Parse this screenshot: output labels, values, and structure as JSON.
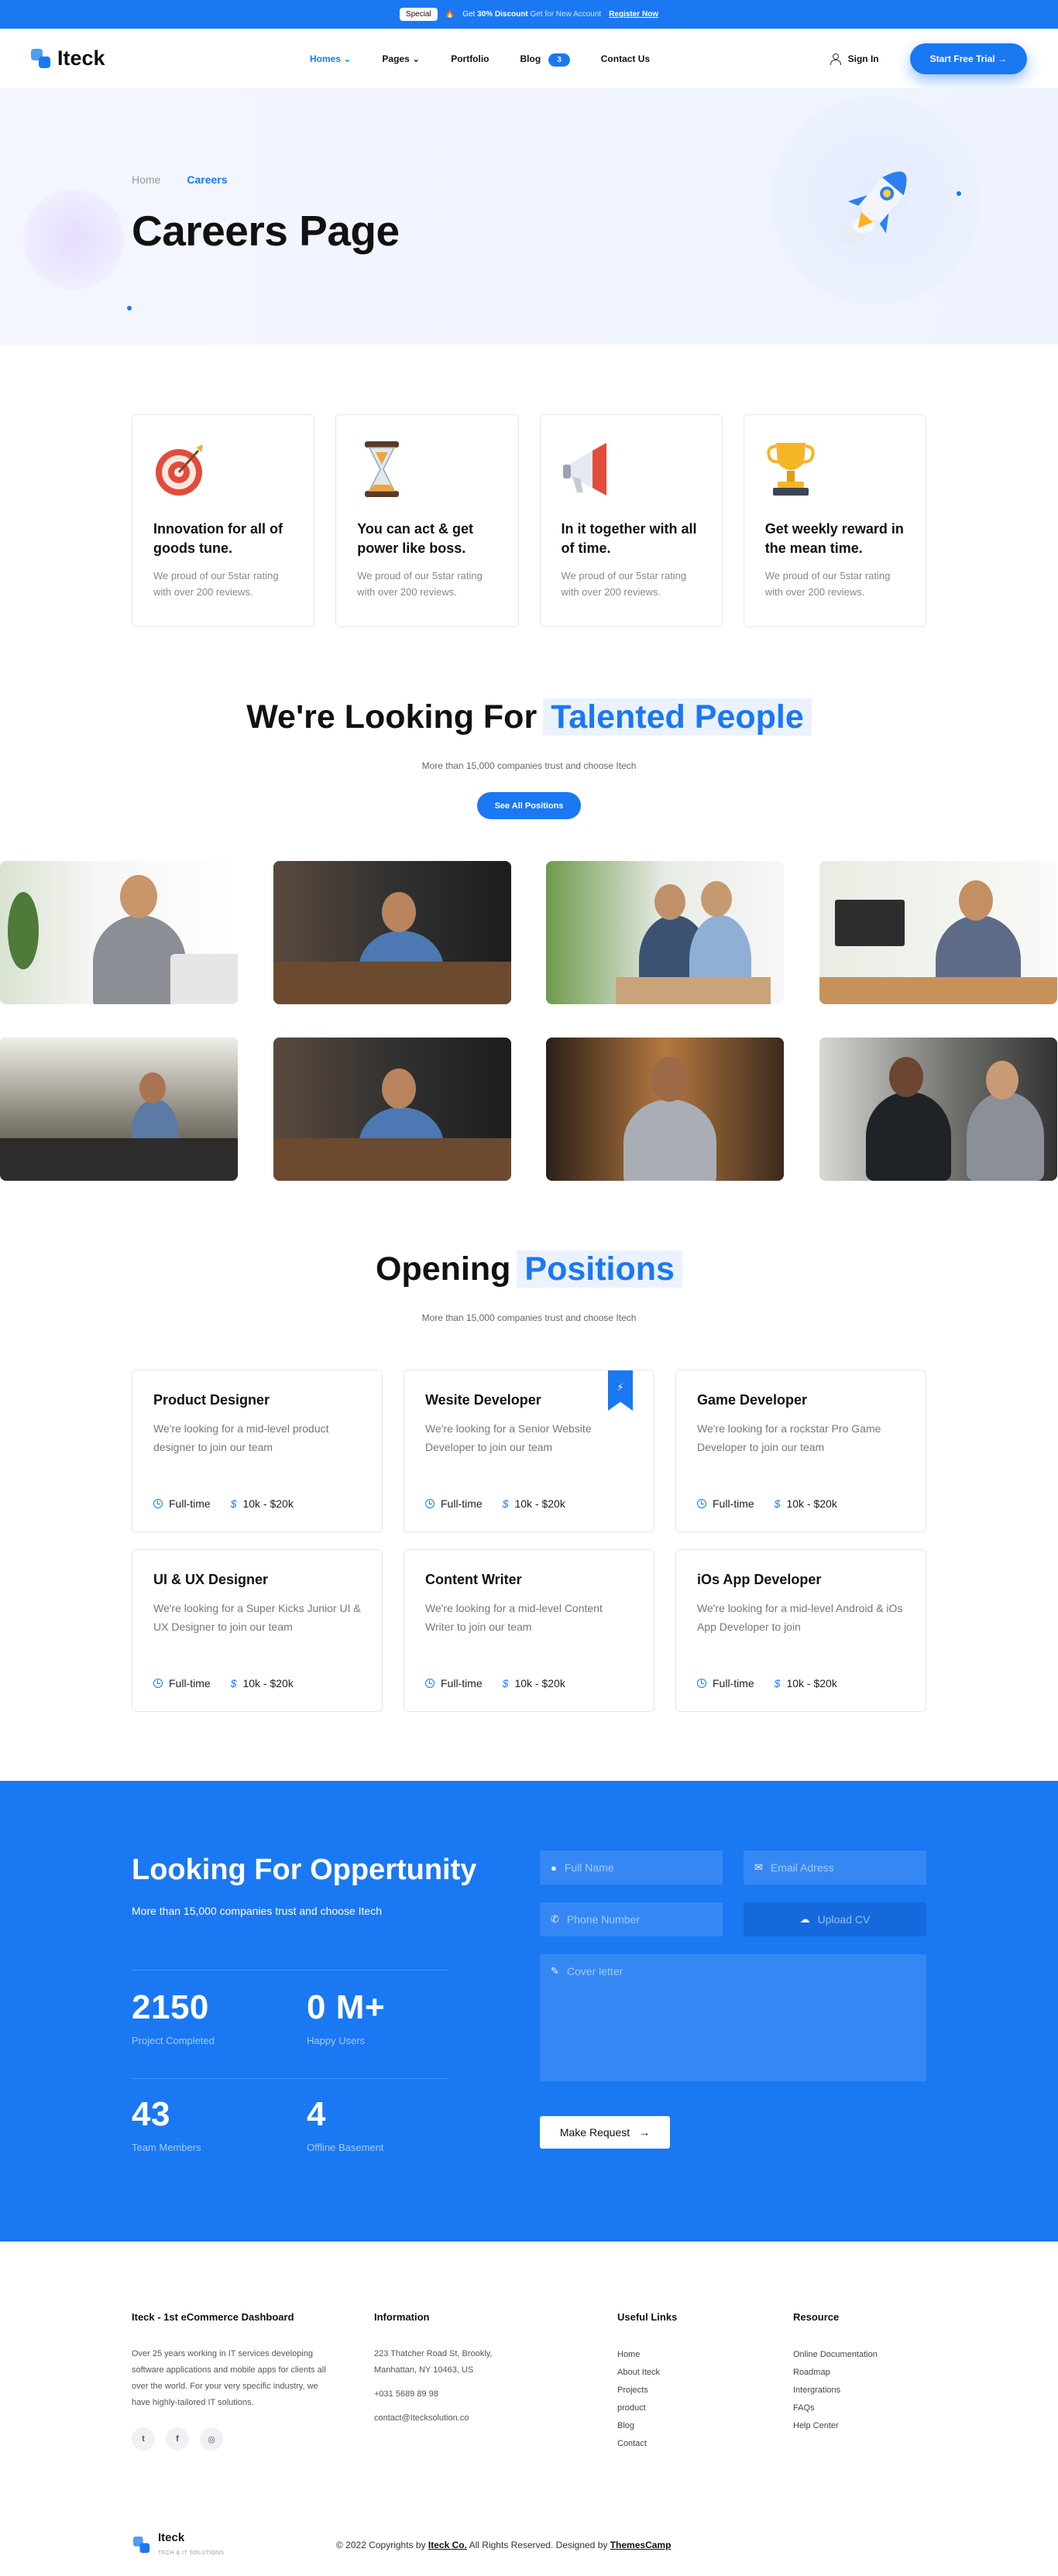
{
  "topbar": {
    "tag": "Special",
    "text_a": "Get",
    "text_discount": "30% Discount",
    "text_b": "Get for New Account",
    "register": "Register Now"
  },
  "header": {
    "brand": "Iteck",
    "nav": [
      {
        "label": "Homes"
      },
      {
        "label": "Pages"
      },
      {
        "label": "Portfolio"
      },
      {
        "label": "Blog"
      },
      {
        "label": "Contact Us"
      }
    ],
    "blog_badge": "3",
    "sign_in": "Sign In",
    "trial_button": "Start Free Trial"
  },
  "hero": {
    "crumb_home": "Home",
    "crumb_current": "Careers",
    "title": "Careers Page"
  },
  "features": [
    {
      "title": "Innovation for all of goods tune.",
      "text": "We proud of our 5star rating with over 200 reviews.",
      "icon": "target-icon"
    },
    {
      "title": "You can act & get power like boss.",
      "text": "We proud of our 5star rating with over 200 reviews.",
      "icon": "hourglass-icon"
    },
    {
      "title": "In it together with all of time.",
      "text": "We proud of our 5star rating with over 200 reviews.",
      "icon": "megaphone-icon"
    },
    {
      "title": "Get weekly reward in the mean time.",
      "text": "We proud of our 5star rating with over 200 reviews.",
      "icon": "trophy-icon"
    }
  ],
  "talent": {
    "title_a": "We're Looking For",
    "title_b": "Talented People",
    "subtitle": "More than 15,000 companies trust and choose Itech",
    "button": "See All Positions"
  },
  "positions": {
    "title_a": "Opening",
    "title_b": "Positions",
    "subtitle": "More than 15,000 companies trust and choose Itech",
    "jobs": [
      {
        "title": "Product Designer",
        "desc": "We're looking for a mid-level product designer to join our team",
        "type": "Full-time",
        "salary": "10k - $20k"
      },
      {
        "title": "Wesite Developer",
        "desc": "We're looking for a Senior Website Developer to join our team",
        "type": "Full-time",
        "salary": "10k - $20k"
      },
      {
        "title": "Game Developer",
        "desc": "We're looking for a rockstar Pro Game Developer to join our team",
        "type": "Full-time",
        "salary": "10k - $20k"
      },
      {
        "title": "UI & UX Designer",
        "desc": "We're looking for a Super Kicks Junior UI & UX Designer to join our team",
        "type": "Full-time",
        "salary": "10k - $20k"
      },
      {
        "title": "Content Writer",
        "desc": "We're looking for a mid-level Content Writer to join our team",
        "type": "Full-time",
        "salary": "10k - $20k"
      },
      {
        "title": "iOs App Developer",
        "desc": "We're looking for a mid-level Android & iOs App Developer to join",
        "type": "Full-time",
        "salary": "10k - $20k"
      }
    ]
  },
  "cta": {
    "title": "Looking For Oppertunity",
    "subtitle": "More than 15,000 companies trust and choose Itech",
    "stats": [
      {
        "num": "2150",
        "label": "Project Completed"
      },
      {
        "num": "0 M+",
        "label": "Happy Users"
      },
      {
        "num": "43",
        "label": "Team Members"
      },
      {
        "num": "4",
        "label": "Offline Basement"
      }
    ],
    "form": {
      "name": "Full Name",
      "email": "Email Adress",
      "phone": "Phone Number",
      "upload": "Upload CV",
      "cover": "Cover letter",
      "submit": "Make Request"
    }
  },
  "footer": {
    "col1_title": "Iteck - 1st eCommerce Dashboard",
    "col1_text": "Over 25 years working in IT services developing software applications and mobile apps for clients all over the world. For your very specific industry, we have highly-tailored IT solutions.",
    "col2_title": "Information",
    "address": "223 Thatcher Road St, Brookly, Manhattan, NY 10463, US",
    "phone": "+031 5689 89 98",
    "email": "contact@Itecksolution.co",
    "col3_title": "Useful Links",
    "links": [
      "Home",
      "About Iteck",
      "Projects",
      "product",
      "Blog",
      "Contact"
    ],
    "col4_title": "Resource",
    "resources": [
      "Online Documentation",
      "Roadmap",
      "Intergrations",
      "FAQs",
      "Help Center"
    ],
    "brand": "Iteck",
    "tagline": "TECH & IT SOLUTIONS",
    "copy_a": "© 2022 Copyrights by",
    "copy_brand": "Iteck Co.",
    "copy_b": "All Rights Reserved. Designed by",
    "copy_designer": "ThemesCamp"
  }
}
